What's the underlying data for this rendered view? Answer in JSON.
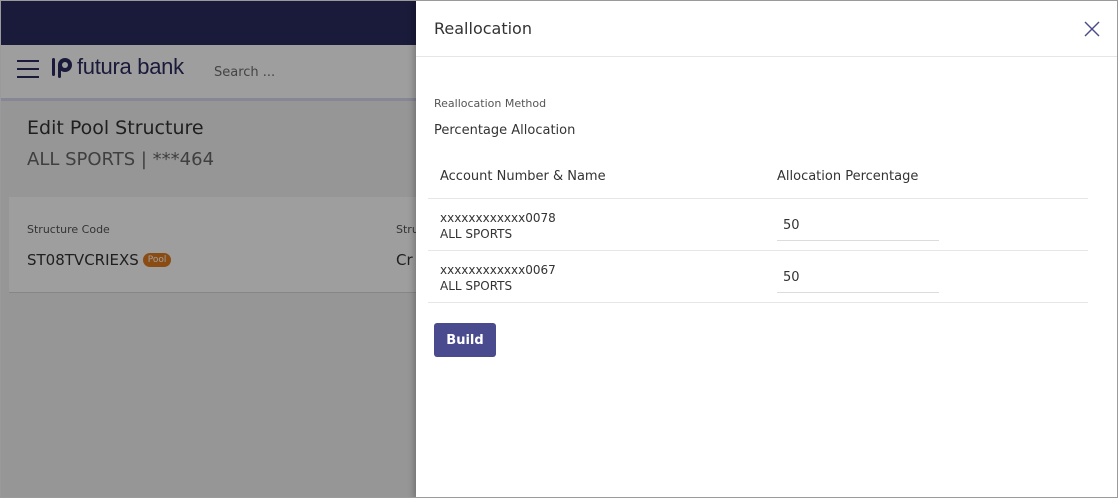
{
  "background": {
    "brand_name": "futura bank",
    "search_placeholder": "Search ...",
    "page_title": "Edit Pool Structure",
    "page_subtitle": "ALL SPORTS | ***464",
    "structure_code_label": "Structure Code",
    "structure_type_label_partial": "Stru",
    "structure_code_value": "ST08TVCRIEXS",
    "pool_badge": "Pool",
    "structure_type_value_partial": "Cr"
  },
  "drawer": {
    "title": "Reallocation",
    "close_icon": "close-icon",
    "method_label": "Reallocation Method",
    "method_value": "Percentage Allocation",
    "table": {
      "headers": [
        "Account Number & Name",
        "Allocation Percentage"
      ],
      "rows": [
        {
          "account_number": "xxxxxxxxxxxx0078",
          "account_name": "ALL SPORTS",
          "percentage": "50"
        },
        {
          "account_number": "xxxxxxxxxxxx0067",
          "account_name": "ALL SPORTS",
          "percentage": "50"
        }
      ]
    },
    "build_label": "Build"
  },
  "colors": {
    "brand": "#2b2a5e",
    "button": "#4a4b8f",
    "badge": "#e07b1f"
  }
}
